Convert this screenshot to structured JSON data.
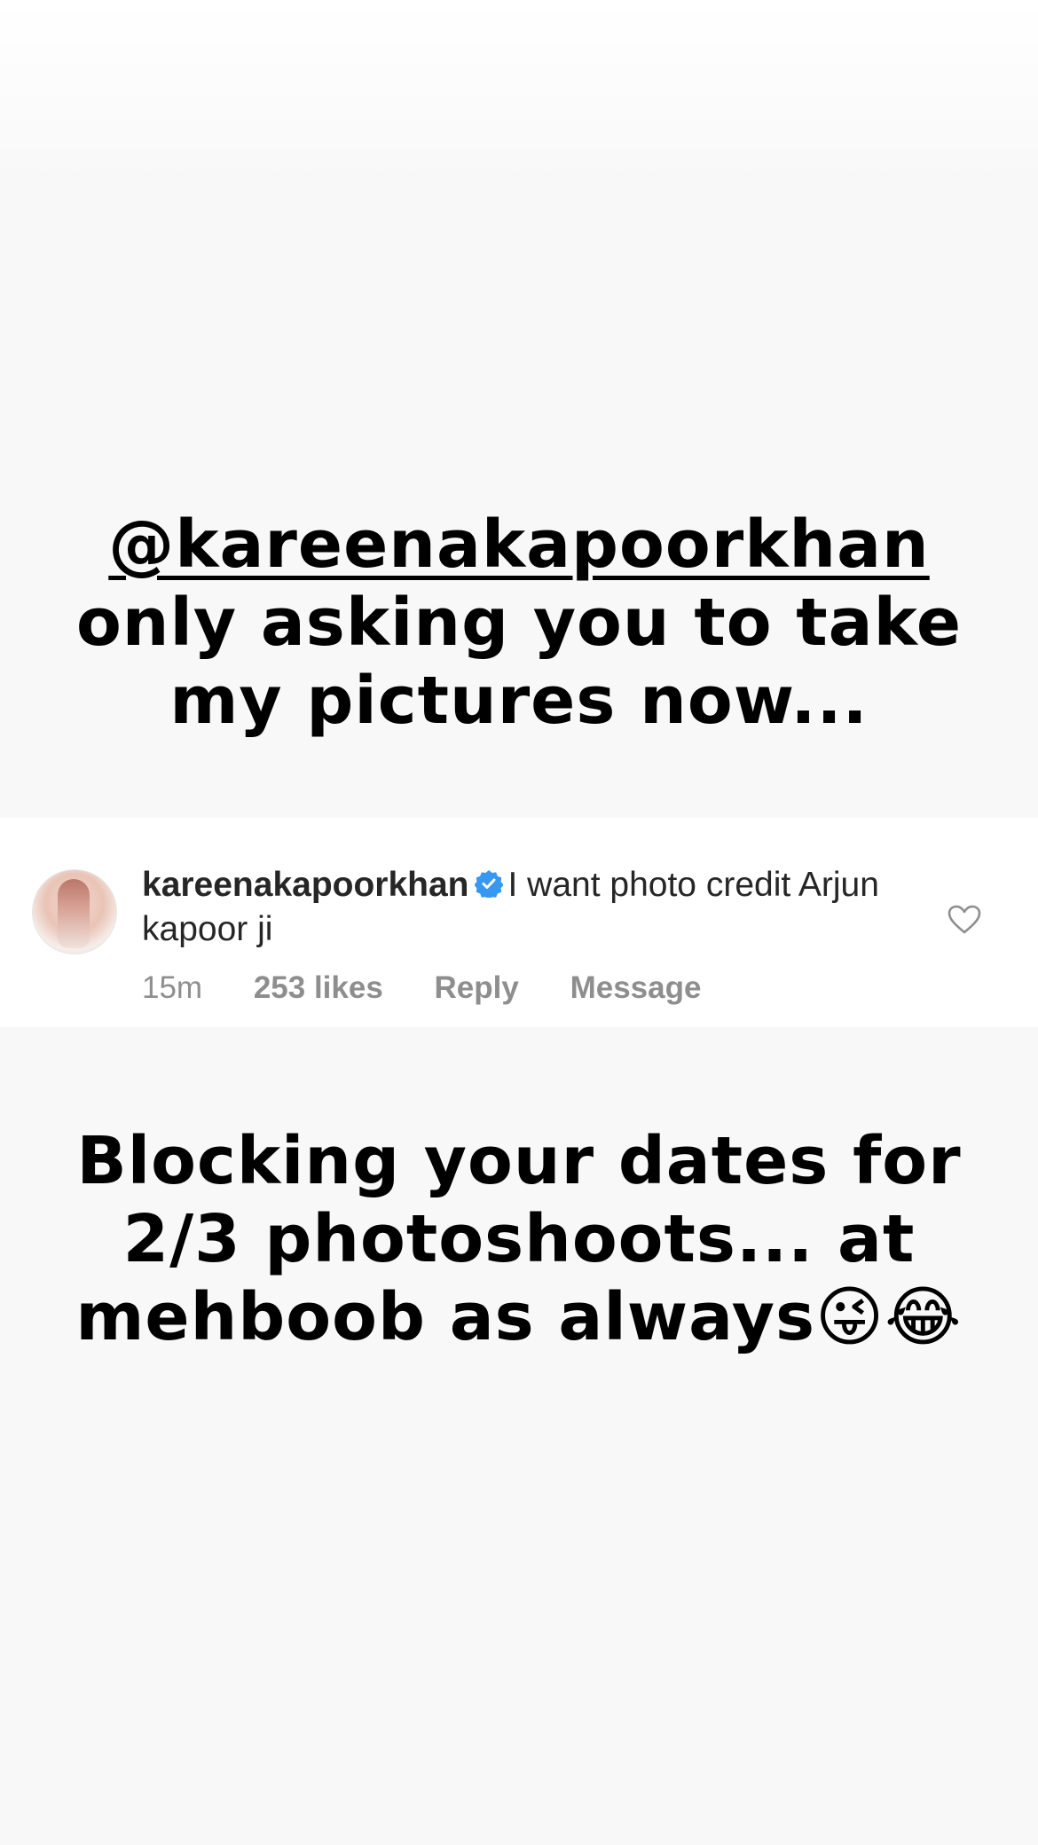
{
  "story": {
    "top_text": {
      "mention": "@kareenakapoorkhan",
      "line2": "only asking you to take",
      "line3": "my pictures now..."
    },
    "bottom_text": {
      "line1": "Blocking your dates for",
      "line2": "2/3 photoshoots... at",
      "line3": "mehboob as always😜😂"
    }
  },
  "comment": {
    "username": "kareenakapoorkhan",
    "verified_icon": "verified-badge-icon",
    "text": "I want photo credit Arjun kapoor ji",
    "time": "15m",
    "likes": "253 likes",
    "reply_label": "Reply",
    "message_label": "Message",
    "like_icon": "heart-icon",
    "colors": {
      "verified": "#3897f0",
      "meta": "#8e8e8e",
      "text": "#262626"
    }
  }
}
